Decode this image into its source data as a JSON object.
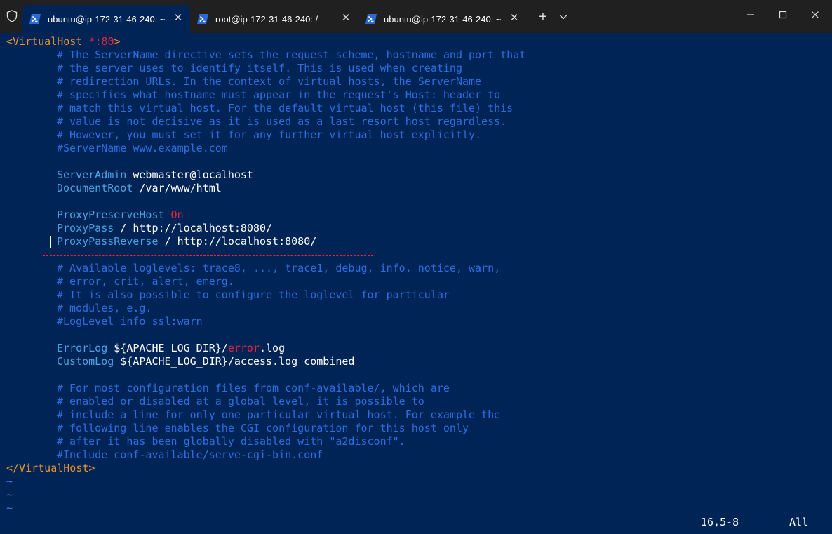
{
  "tabs": [
    {
      "label": "ubuntu@ip-172-31-46-240: ~",
      "active": true
    },
    {
      "label": "root@ip-172-31-46-240: /",
      "active": false
    },
    {
      "label": "ubuntu@ip-172-31-46-240: ~",
      "active": false
    }
  ],
  "icons": {
    "shield": "shield-icon",
    "powershell": "powershell-icon",
    "close": "close-icon",
    "new_tab": "plus-icon",
    "dropdown": "chevron-down-icon",
    "minimize": "minimize-icon",
    "maximize": "maximize-icon",
    "window_close": "window-close-icon"
  },
  "titlebar_controls": {
    "new_tab": "+",
    "close_glyph": "✕"
  },
  "colors": {
    "terminal_bg": "#012456",
    "titlebar_bg": "#202020",
    "comment": "#2c6ee0",
    "directive": "#4ba3e3",
    "tag": "#e6962c",
    "highlight_box": "#e0263d"
  },
  "editor": {
    "vhost_open": {
      "lt": "<",
      "tag": "VirtualHost",
      "sp": " ",
      "star": "*",
      "port": ":80",
      "gt": ">"
    },
    "comments1": [
      "# The ServerName directive sets the request scheme, hostname and port that",
      "# the server uses to identify itself. This is used when creating",
      "# redirection URLs. In the context of virtual hosts, the ServerName",
      "# specifies what hostname must appear in the request's Host: header to",
      "# match this virtual host. For the default virtual host (this file) this",
      "# value is not decisive as it is used as a last resort host regardless.",
      "# However, you must set it for any further virtual host explicitly.",
      "#ServerName www.example.com"
    ],
    "server_admin": {
      "key": "ServerAdmin",
      "value": " webmaster@localhost"
    },
    "document_root": {
      "key": "DocumentRoot",
      "value": " /var/www/html"
    },
    "proxy_preserve": {
      "key": "ProxyPreserveHost",
      "value": " On"
    },
    "proxy_pass": {
      "key": "ProxyPass",
      "value": " / http://localhost:8080/"
    },
    "proxy_reverse": {
      "key": "ProxyPassReverse",
      "value": " / http://localhost:8080/"
    },
    "comments2": [
      "# Available loglevels: trace8, ..., trace1, debug, info, notice, warn,",
      "# error, crit, alert, emerg.",
      "# It is also possible to configure the loglevel for particular",
      "# modules, e.g.",
      "#LogLevel info ssl:warn"
    ],
    "error_log": {
      "key": "ErrorLog",
      "value_a": " ${APACHE_LOG_DIR}/",
      "value_red": "error",
      "value_b": ".log"
    },
    "custom_log": {
      "key": "CustomLog",
      "value": " ${APACHE_LOG_DIR}/access.log combined"
    },
    "comments3": [
      "# For most configuration files from conf-available/, which are",
      "# enabled or disabled at a global level, it is possible to",
      "# include a line for only one particular virtual host. For example the",
      "# following line enables the CGI configuration for this host only",
      "# after it has been globally disabled with \"a2disconf\".",
      "#Include conf-available/serve-cgi-bin.conf"
    ],
    "vhost_close": "</VirtualHost>",
    "tilde": "~"
  },
  "status": {
    "position": "16,5-8",
    "scroll": "All"
  }
}
